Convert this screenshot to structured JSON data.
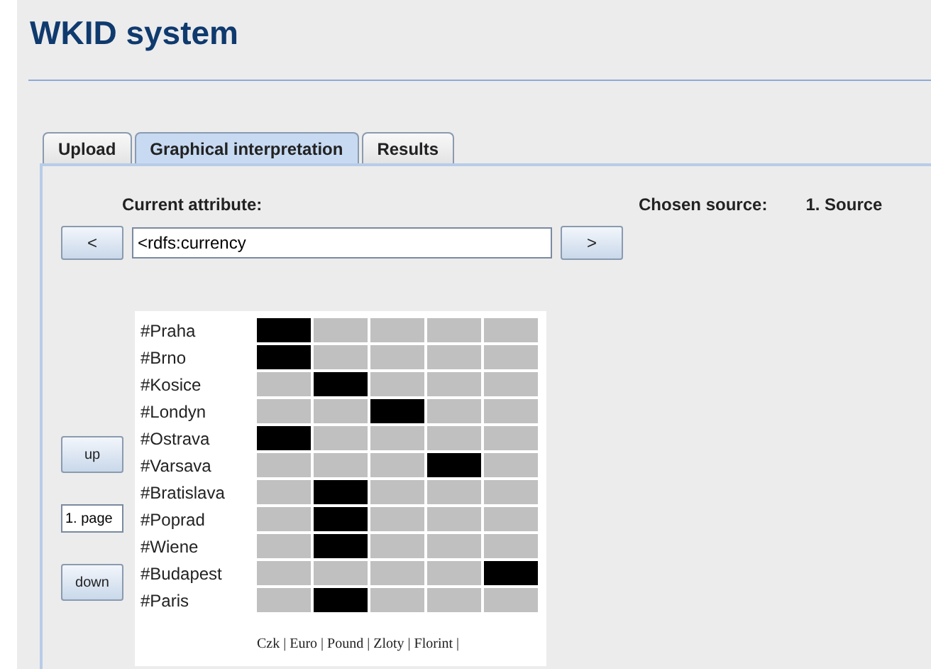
{
  "title": "WKID system",
  "tabs": [
    {
      "label": "Upload",
      "selected": false
    },
    {
      "label": "Graphical interpretation",
      "selected": true
    },
    {
      "label": "Results",
      "selected": false
    }
  ],
  "attribute": {
    "label": "Current attribute:",
    "prev": "<",
    "value": "<rdfs:currency",
    "next": ">"
  },
  "source": {
    "label": "Chosen source:",
    "value": "1. Source"
  },
  "pager": {
    "up": "up",
    "page": "1. page",
    "down": "down"
  },
  "matrix": {
    "rows": [
      {
        "label": "#Praha",
        "cells": [
          true,
          false,
          false,
          false,
          false
        ]
      },
      {
        "label": "#Brno",
        "cells": [
          true,
          false,
          false,
          false,
          false
        ]
      },
      {
        "label": "#Kosice",
        "cells": [
          false,
          true,
          false,
          false,
          false
        ]
      },
      {
        "label": "#Londyn",
        "cells": [
          false,
          false,
          true,
          false,
          false
        ]
      },
      {
        "label": "#Ostrava",
        "cells": [
          true,
          false,
          false,
          false,
          false
        ]
      },
      {
        "label": "#Varsava",
        "cells": [
          false,
          false,
          false,
          true,
          false
        ]
      },
      {
        "label": "#Bratislava",
        "cells": [
          false,
          true,
          false,
          false,
          false
        ]
      },
      {
        "label": "#Poprad",
        "cells": [
          false,
          true,
          false,
          false,
          false
        ]
      },
      {
        "label": "#Wiene",
        "cells": [
          false,
          true,
          false,
          false,
          false
        ]
      },
      {
        "label": "#Budapest",
        "cells": [
          false,
          false,
          false,
          false,
          true
        ]
      },
      {
        "label": "#Paris",
        "cells": [
          false,
          true,
          false,
          false,
          false
        ]
      }
    ],
    "legend": "Czk | Euro | Pound | Zloty | Florint |"
  }
}
